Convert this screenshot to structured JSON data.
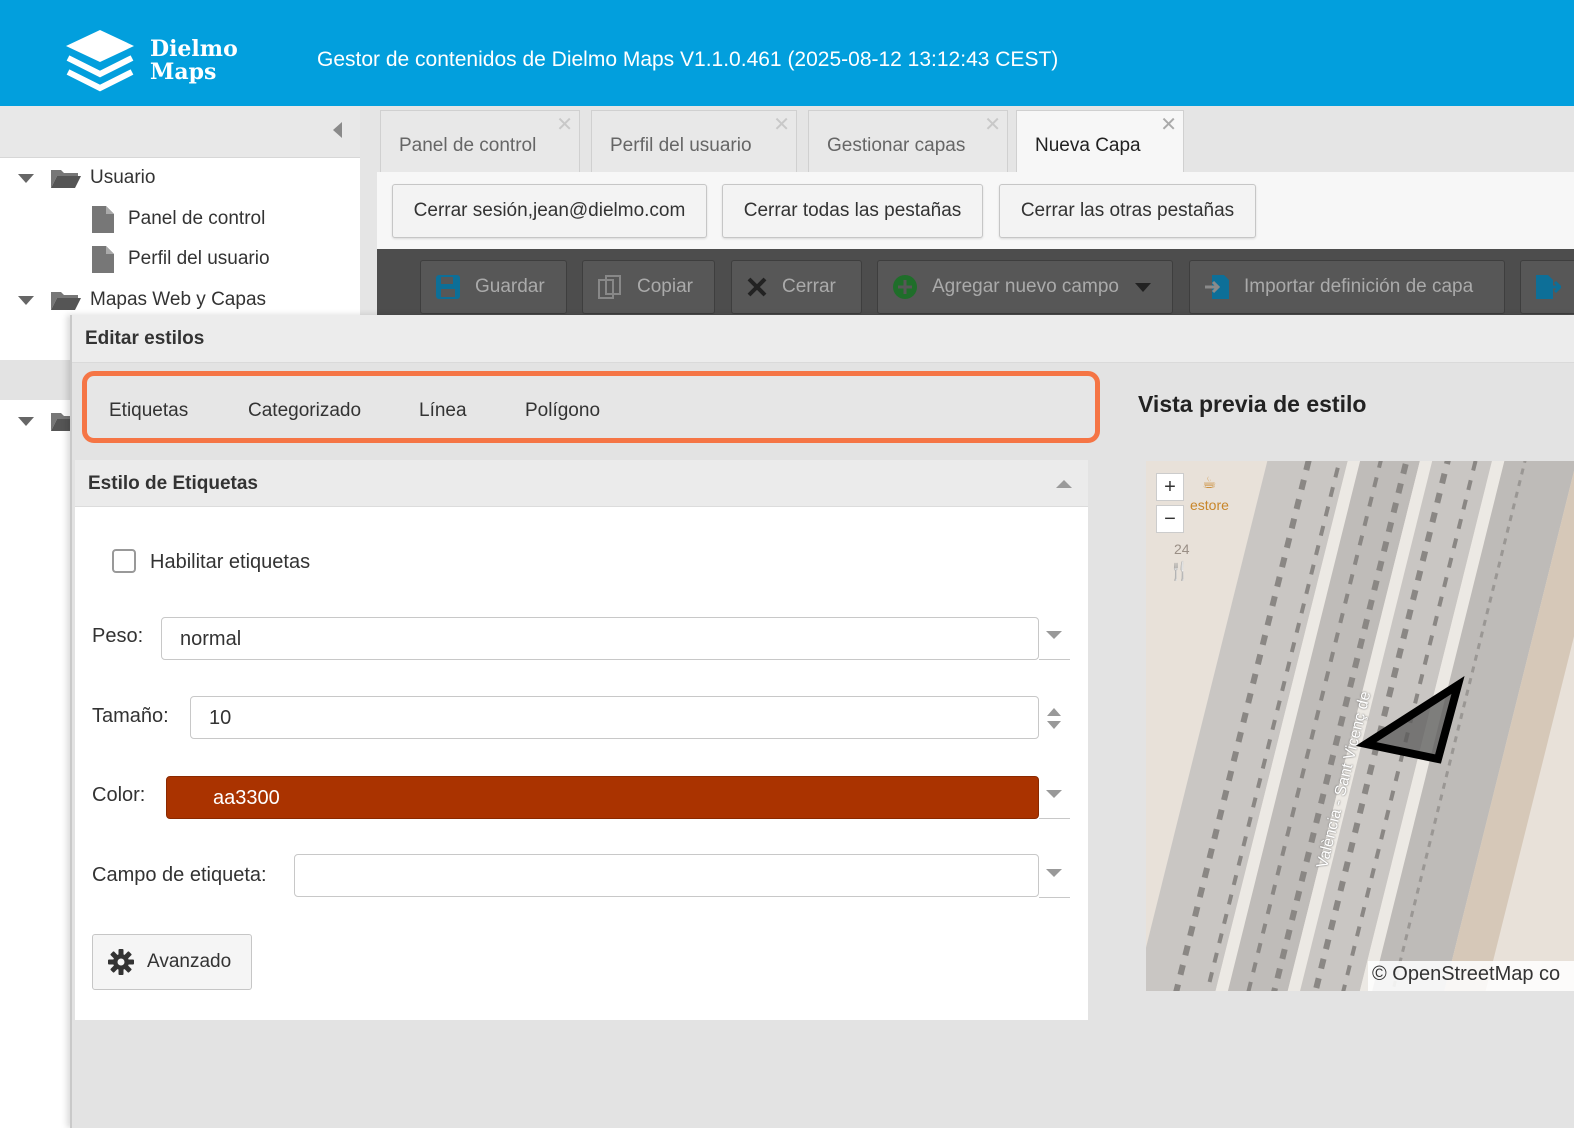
{
  "header": {
    "logo_line1": "Dielmo",
    "logo_line2": "Maps",
    "title": "Gestor de contenidos de Dielmo Maps V1.1.0.461 (2025-08-12 13:12:43 CEST)"
  },
  "sidebar": {
    "tree": [
      {
        "label": "Usuario",
        "type": "folder"
      },
      {
        "label": "Panel de control",
        "type": "file"
      },
      {
        "label": "Perfil del usuario",
        "type": "file"
      },
      {
        "label": "Mapas Web y Capas",
        "type": "folder"
      }
    ]
  },
  "tabs": [
    {
      "label": "Panel de control",
      "active": false
    },
    {
      "label": "Perfil del usuario",
      "active": false
    },
    {
      "label": "Gestionar capas",
      "active": false
    },
    {
      "label": "Nueva Capa",
      "active": true
    }
  ],
  "session_buttons": {
    "logout": "Cerrar sesión,jean@dielmo.com",
    "close_all": "Cerrar todas las pestañas",
    "close_others": "Cerrar las otras pestañas"
  },
  "toolbar": {
    "save": "Guardar",
    "copy": "Copiar",
    "close": "Cerrar",
    "add_field": "Agregar nuevo campo",
    "import_def": "Importar definición de capa"
  },
  "dialog": {
    "title": "Editar estilos",
    "style_tabs": [
      "Etiquetas",
      "Categorizado",
      "Línea",
      "Polígono"
    ],
    "panel_title": "Estilo de Etiquetas",
    "enable_labels": "Habilitar etiquetas",
    "weight_label": "Peso:",
    "weight_value": "normal",
    "size_label": "Tamaño:",
    "size_value": "10",
    "color_label": "Color:",
    "color_value": "aa3300",
    "color_hex": "#aa3300",
    "label_field_label": "Campo de etiqueta:",
    "label_field_value": "",
    "advanced": "Avanzado"
  },
  "preview": {
    "title": "Vista previa de estilo",
    "zoom_in": "+",
    "zoom_out": "−",
    "attribution": "© OpenStreetMap co",
    "map_labels": {
      "poi1": "estore",
      "number": "24",
      "street": "València - Sant Vicenç de"
    }
  },
  "colors": {
    "header_bg": "#029fdd",
    "highlight": "#f57545",
    "color_swatch": "#aa3300"
  }
}
